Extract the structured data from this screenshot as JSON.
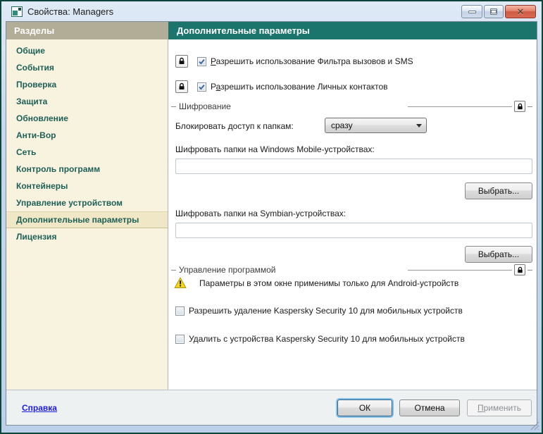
{
  "window": {
    "title": "Свойства: Managers"
  },
  "titlebar_controls": {
    "minimize": "minimize",
    "maximize": "maximize",
    "close": "close"
  },
  "sidebar": {
    "header": "Разделы",
    "items": [
      {
        "label": "Общие",
        "selected": false
      },
      {
        "label": "События",
        "selected": false
      },
      {
        "label": "Проверка",
        "selected": false
      },
      {
        "label": "Защита",
        "selected": false
      },
      {
        "label": "Обновление",
        "selected": false
      },
      {
        "label": "Анти-Вор",
        "selected": false
      },
      {
        "label": "Сеть",
        "selected": false
      },
      {
        "label": "Контроль программ",
        "selected": false
      },
      {
        "label": "Контейнеры",
        "selected": false
      },
      {
        "label": "Управление устройством",
        "selected": false
      },
      {
        "label": "Дополнительные параметры",
        "selected": true
      },
      {
        "label": "Лицензия",
        "selected": false
      }
    ]
  },
  "main": {
    "header": "Дополнительные параметры",
    "checkbox_sms": {
      "pre": "",
      "accel": "Р",
      "rest": "азрешить использование Фильтра вызовов и SMS",
      "checked": true,
      "locked": true
    },
    "checkbox_contacts": {
      "pre": "Р",
      "accel": "а",
      "rest": "зрешить использование Личных контактов",
      "checked": true,
      "locked": true
    },
    "section_encryption": {
      "title": "Шифрование",
      "lock_icon": "lock-icon"
    },
    "block_access_label": "Блокировать доступ к папкам:",
    "block_access_value": "сразу",
    "wm_label": "Шифровать папки на Windows Mobile-устройствах:",
    "wm_value": "",
    "choose_label": "Выбрать...",
    "symbian_label": "Шифровать папки на Symbian-устройствах:",
    "symbian_value": "",
    "section_management": {
      "title": "Управление программой",
      "lock_icon": "lock-icon"
    },
    "warning_text": "Параметры в этом окне применимы только для Android-устройств",
    "checkbox_allow_removal": {
      "label": "Разрешить удаление Kaspersky Security 10 для мобильных устройств",
      "checked": false
    },
    "checkbox_remove_device": {
      "label": "Удалить с устройства Kaspersky Security 10 для мобильных устройств",
      "checked": false
    }
  },
  "footer": {
    "help_label": "Справка",
    "ok_label": "ОК",
    "cancel_label": "Отмена",
    "apply": {
      "pre": "",
      "accel": "П",
      "rest": "рименить",
      "enabled": false
    }
  },
  "colors": {
    "header_teal": "#1b756c",
    "sidebar_header_bg": "#b2ad97",
    "sidebar_bg": "#f8f3df",
    "sidebar_selected_bg": "#efe7c5",
    "sidebar_text": "#1e6058",
    "link_blue": "#1c1ce0",
    "warning_yellow": "#f7d517",
    "close_button_red": "#d05a43"
  }
}
